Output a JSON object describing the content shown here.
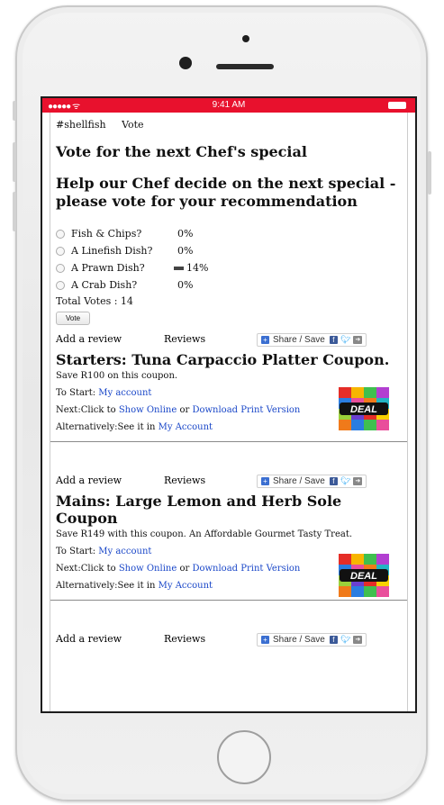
{
  "status_bar": {
    "signal": "●●●●● ᯤ",
    "time": "9:41 AM"
  },
  "breadcrumb": {
    "tag": "#shellfish",
    "page": "Vote"
  },
  "page_title": "Vote for the next Chef's special",
  "poll": {
    "question": "Help our Chef decide on the next special - please vote for your recommendation",
    "options": [
      {
        "label": "Fish & Chips?",
        "percent": "0%",
        "value": 0
      },
      {
        "label": "A Linefish Dish?",
        "percent": "0%",
        "value": 0
      },
      {
        "label": "A Prawn Dish?",
        "percent": "14%",
        "value": 14
      },
      {
        "label": "A Crab Dish?",
        "percent": "0%",
        "value": 0
      }
    ],
    "total_label": "Total Votes : 14",
    "vote_button": "Vote"
  },
  "review_bar": {
    "add_review": "Add a review",
    "reviews": "Reviews",
    "share": "Share / Save"
  },
  "coupons": [
    {
      "title": "Starters: Tuna Carpaccio Platter Coupon.",
      "description": "Save R100 on this coupon.",
      "start_prefix": "To Start: ",
      "start_link": "My account",
      "next_prefix": "Next:Click to ",
      "show_online": "Show Online",
      "or_text": " or ",
      "download": "Download Print Version",
      "alt_prefix": "Alternatively:See it in ",
      "alt_link": "My Account",
      "badge": "DEAL"
    },
    {
      "title": "Mains: Large Lemon and Herb Sole Coupon",
      "description": "Save R149 with this coupon. An Affordable Gourmet Tasty Treat.",
      "start_prefix": "To Start: ",
      "start_link": "My account",
      "next_prefix": "Next:Click to ",
      "show_online": "Show Online",
      "or_text": " or ",
      "download": "Download Print Version",
      "alt_prefix": "Alternatively:See it in ",
      "alt_link": "My Account",
      "badge": "DEAL"
    }
  ],
  "colors": {
    "status_bar": "#e8112d",
    "link": "#1a47c8"
  }
}
